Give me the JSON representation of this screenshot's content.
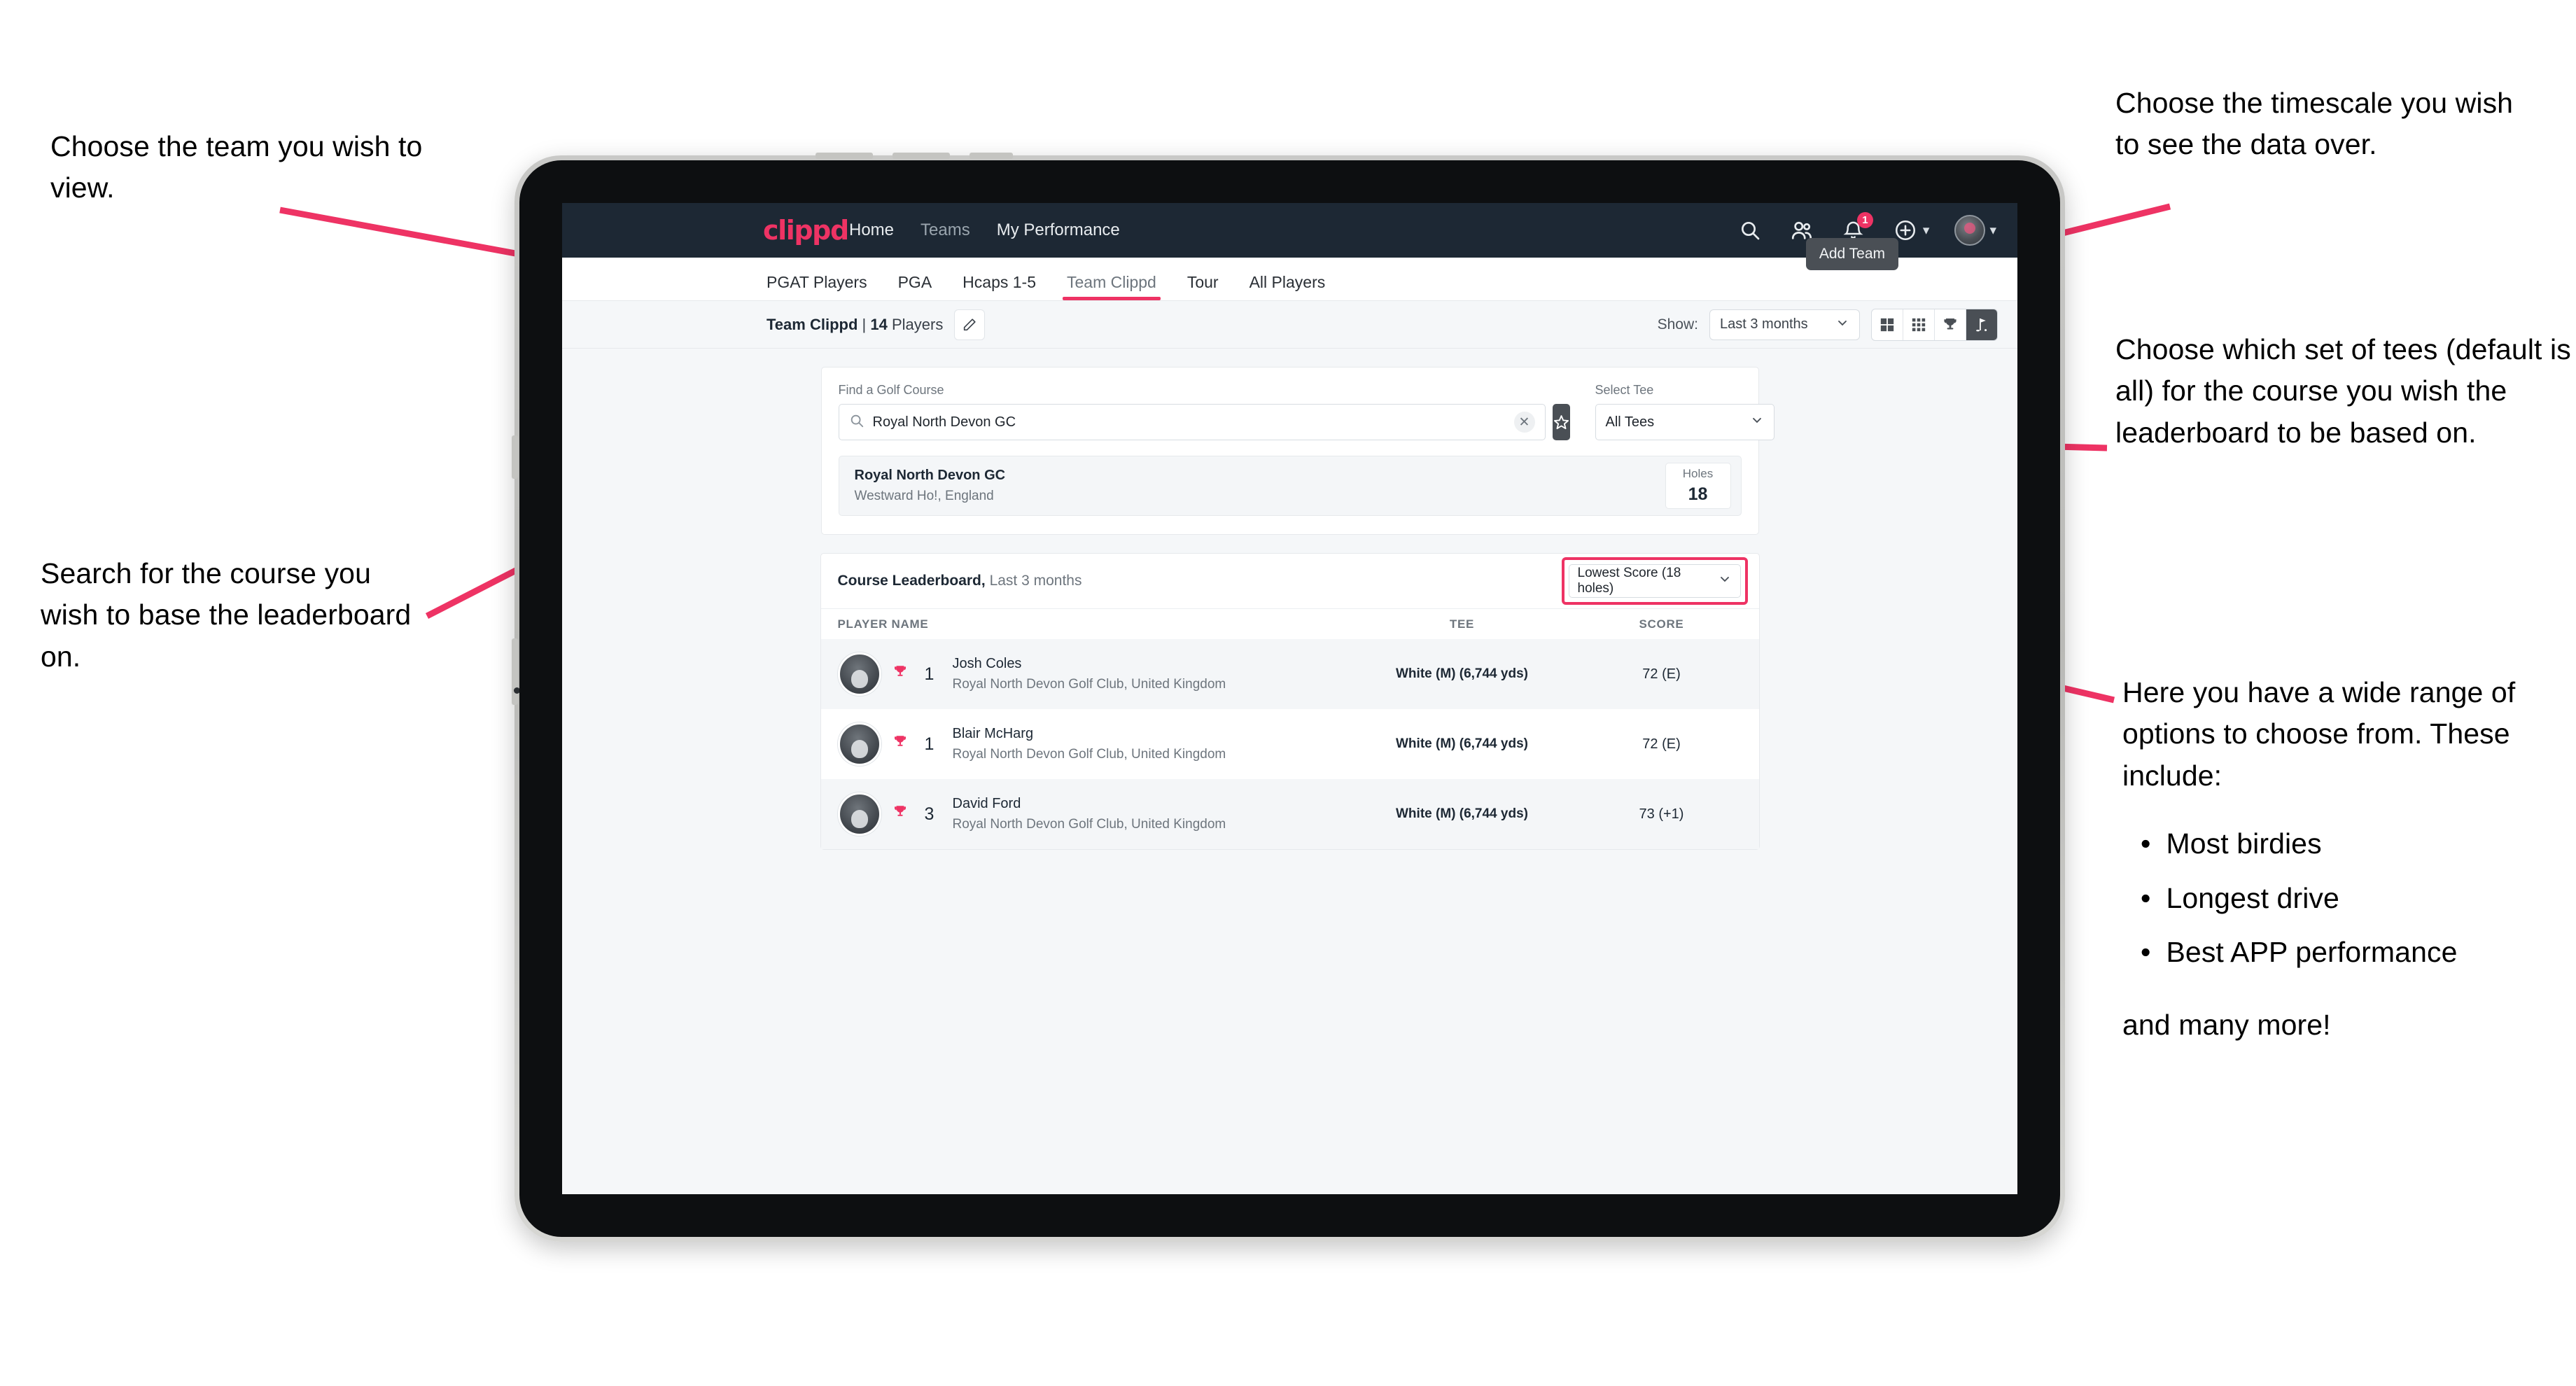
{
  "annotations": {
    "choose_team": "Choose the team you wish to view.",
    "search_course": "Search for the course you wish to base the leaderboard on.",
    "timescale": "Choose the timescale you wish to see the data over.",
    "tees": "Choose which set of tees (default is all) for the course you wish the leaderboard to be based on.",
    "options_intro": "Here you have a wide range of options to choose from. These include:",
    "options_bullets": [
      "Most birdies",
      "Longest drive",
      "Best APP performance"
    ],
    "options_tail": "and many more!"
  },
  "app": {
    "brand": "clippd",
    "brand_color": "#ee3364",
    "nav": [
      {
        "label": "Home",
        "active": true
      },
      {
        "label": "Teams",
        "active": false
      },
      {
        "label": "My Performance",
        "active": true
      }
    ],
    "header_icons": [
      {
        "name": "search-icon"
      },
      {
        "name": "people-icon"
      },
      {
        "name": "bell-icon",
        "badge": "1"
      },
      {
        "name": "plus-icon"
      },
      {
        "name": "profile-avatar"
      }
    ],
    "tooltip": "Add Team"
  },
  "tabs": [
    {
      "label": "PGAT Players",
      "active": false
    },
    {
      "label": "PGA",
      "active": false
    },
    {
      "label": "Hcaps 1-5",
      "active": false
    },
    {
      "label": "Team Clippd",
      "active": true
    },
    {
      "label": "Tour",
      "active": false
    },
    {
      "label": "All Players",
      "active": false
    }
  ],
  "toolbar": {
    "team_name": "Team Clippd",
    "separator": "|",
    "player_count": "14",
    "players_word": "Players",
    "edit_icon": "pencil-icon",
    "show_label": "Show:",
    "period_value": "Last 3 months",
    "views": [
      {
        "name": "grid-large-view",
        "active": false
      },
      {
        "name": "grid-small-view",
        "active": false
      },
      {
        "name": "trophy-view",
        "active": false
      },
      {
        "name": "course-view",
        "active": true
      }
    ]
  },
  "search_panel": {
    "course_label": "Find a Golf Course",
    "course_value": "Royal North Devon GC",
    "course_placeholder": "Find a Golf Course",
    "clear_icon": "close-icon",
    "favourite_icon": "star-icon",
    "tee_label": "Select Tee",
    "tee_value": "All Tees"
  },
  "course_result": {
    "name": "Royal North Devon GC",
    "location": "Westward Ho!, England",
    "holes_label": "Holes",
    "holes_value": "18"
  },
  "leaderboard": {
    "title": "Course Leaderboard,",
    "subtitle": "Last 3 months",
    "metric_value": "Lowest Score (18 holes)",
    "highlight_color": "#ee3364",
    "columns": [
      "PLAYER NAME",
      "TEE",
      "SCORE"
    ],
    "rows": [
      {
        "rank": "1",
        "name": "Josh Coles",
        "club": "Royal North Devon Golf Club, United Kingdom",
        "tee": "White (M) (6,744 yds)",
        "score": "72 (E)"
      },
      {
        "rank": "1",
        "name": "Blair McHarg",
        "club": "Royal North Devon Golf Club, United Kingdom",
        "tee": "White (M) (6,744 yds)",
        "score": "72 (E)"
      },
      {
        "rank": "3",
        "name": "David Ford",
        "club": "Royal North Devon Golf Club, United Kingdom",
        "tee": "White (M) (6,744 yds)",
        "score": "73 (+1)"
      }
    ]
  }
}
